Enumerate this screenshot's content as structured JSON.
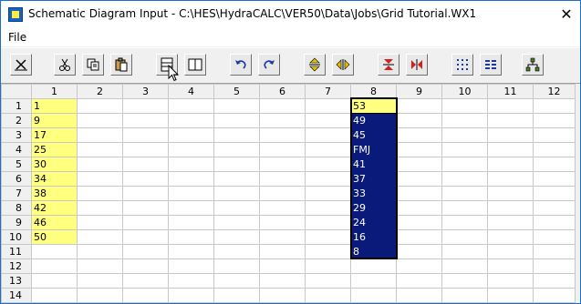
{
  "window": {
    "title": "Schematic Diagram Input - C:\\HES\\HydraCALC\\VER50\\Data\\Jobs\\Grid Tutorial.WX1",
    "close_glyph": "✕"
  },
  "menu": {
    "file_label": "File"
  },
  "toolbar": {
    "buttons": [
      {
        "icon": "delete-icon"
      },
      {
        "icon": "cut-icon"
      },
      {
        "icon": "copy-icon"
      },
      {
        "icon": "paste-icon"
      },
      {
        "icon": "insert-row-icon"
      },
      {
        "icon": "insert-column-icon"
      },
      {
        "icon": "undo-icon"
      },
      {
        "icon": "redo-icon"
      },
      {
        "icon": "expand-vertical-icon"
      },
      {
        "icon": "expand-horizontal-icon"
      },
      {
        "icon": "compress-vertical-icon"
      },
      {
        "icon": "compress-horizontal-icon"
      },
      {
        "icon": "grid-columns-icon"
      },
      {
        "icon": "grid-rows-icon"
      },
      {
        "icon": "tree-diagram-icon"
      }
    ]
  },
  "grid": {
    "columns": [
      "1",
      "2",
      "3",
      "4",
      "5",
      "6",
      "7",
      "8",
      "9",
      "10",
      "11",
      "12"
    ],
    "rows": [
      "1",
      "2",
      "3",
      "4",
      "5",
      "6",
      "7",
      "8",
      "9",
      "10",
      "11",
      "12",
      "13",
      "14"
    ],
    "col1_values": [
      "1",
      "9",
      "17",
      "25",
      "30",
      "34",
      "38",
      "42",
      "46",
      "50"
    ],
    "col8_values": [
      "53",
      "49",
      "45",
      "FMJ",
      "41",
      "37",
      "33",
      "29",
      "24",
      "16",
      "8"
    ],
    "colors": {
      "highlight": "#ffff80",
      "selection": "#0a1a7a"
    }
  }
}
